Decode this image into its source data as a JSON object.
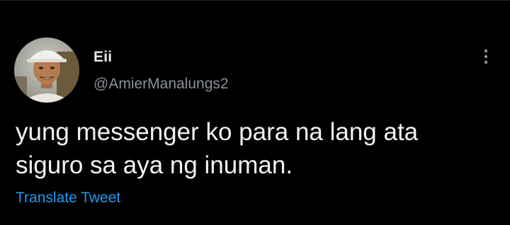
{
  "tweet": {
    "author": {
      "display_name": "Eii",
      "handle": "@AmierManalungs2",
      "avatar_icon": "user-avatar"
    },
    "text": "yung messenger ko para na lang ata\nsiguro sa aya ng inuman.",
    "translate_label": "Translate Tweet",
    "more_icon": "more-vertical-icon"
  },
  "colors": {
    "background": "#000000",
    "text": "#e7e9ea",
    "secondary_text": "#8b9197",
    "link": "#1d9bf0"
  }
}
